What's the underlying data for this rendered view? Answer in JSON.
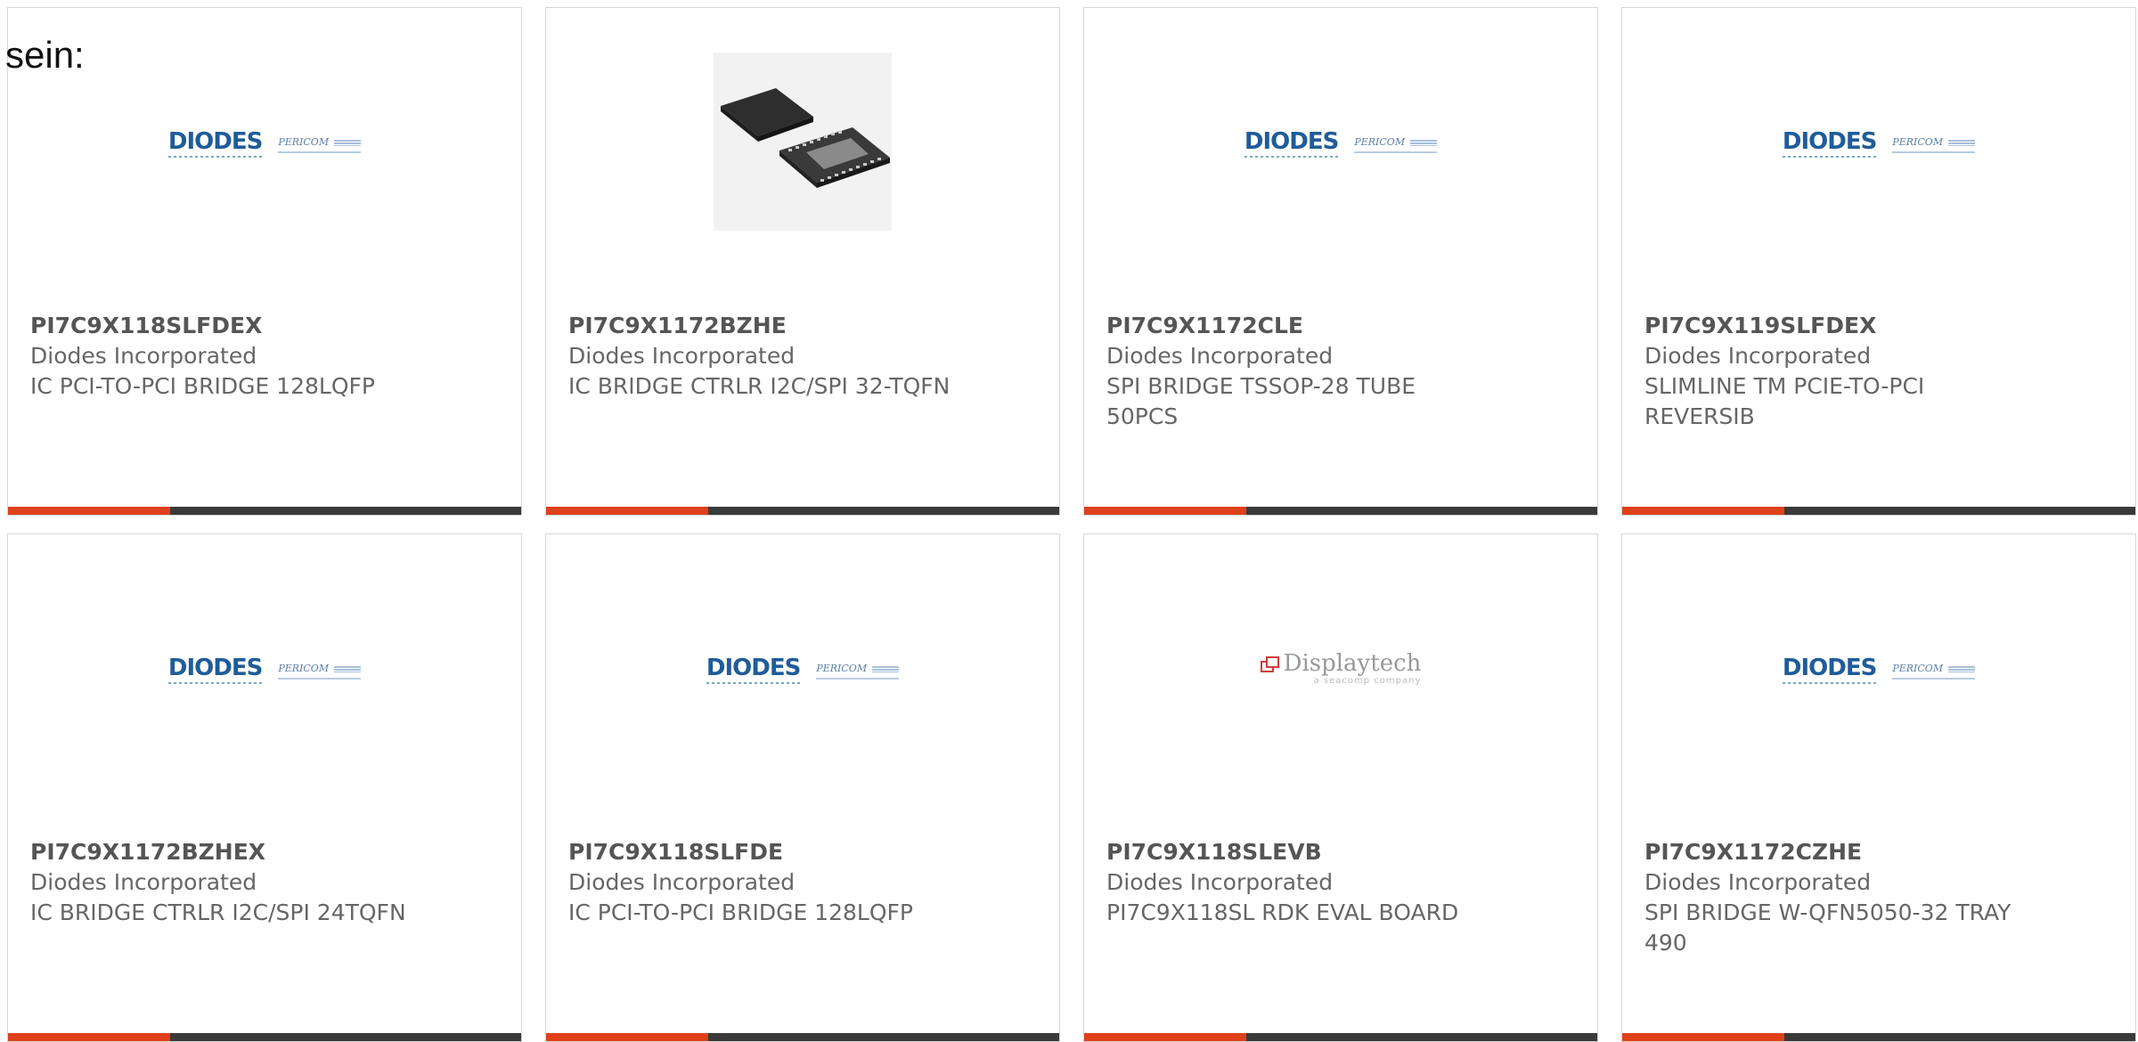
{
  "heading": "sein:",
  "products": [
    {
      "part_number": "PI7C9X118SLFDEX",
      "manufacturer": "Diodes Incorporated",
      "description": "IC PCI-TO-PCI BRIDGE 128LQFP",
      "image": "diodes-pericom-logo"
    },
    {
      "part_number": "PI7C9X1172BZHE",
      "manufacturer": "Diodes Incorporated",
      "description": "IC BRIDGE CTRLR I2C/SPI 32-TQFN",
      "image": "qfn-chip-photo"
    },
    {
      "part_number": "PI7C9X1172CLE",
      "manufacturer": "Diodes Incorporated",
      "description": "SPI BRIDGE TSSOP-28 TUBE 50PCS",
      "image": "diodes-pericom-logo"
    },
    {
      "part_number": "PI7C9X119SLFDEX",
      "manufacturer": "Diodes Incorporated",
      "description": "SLIMLINE TM PCIE-TO-PCI REVERSIB",
      "image": "diodes-pericom-logo"
    },
    {
      "part_number": "PI7C9X1172BZHEX",
      "manufacturer": "Diodes Incorporated",
      "description": "IC BRIDGE CTRLR I2C/SPI 24TQFN",
      "image": "diodes-pericom-logo"
    },
    {
      "part_number": "PI7C9X118SLFDE",
      "manufacturer": "Diodes Incorporated",
      "description": "IC PCI-TO-PCI BRIDGE 128LQFP",
      "image": "diodes-pericom-logo"
    },
    {
      "part_number": "PI7C9X118SLEVB",
      "manufacturer": "Diodes Incorporated",
      "description": "PI7C9X118SL RDK EVAL BOARD",
      "image": "displaytech-logo"
    },
    {
      "part_number": "PI7C9X1172CZHE",
      "manufacturer": "Diodes Incorporated",
      "description": "SPI BRIDGE W-QFN5050-32 TRAY 490",
      "image": "diodes-pericom-logo"
    }
  ],
  "logos": {
    "diodes": "DIODES",
    "pericom": "PERICOM",
    "displaytech": "Displaytech",
    "displaytech_sub": "a seacomp company"
  },
  "colors": {
    "accent": "#e0401a",
    "bar": "#3a3a3a",
    "diodes_blue": "#1f5c99",
    "text": "#666666"
  }
}
